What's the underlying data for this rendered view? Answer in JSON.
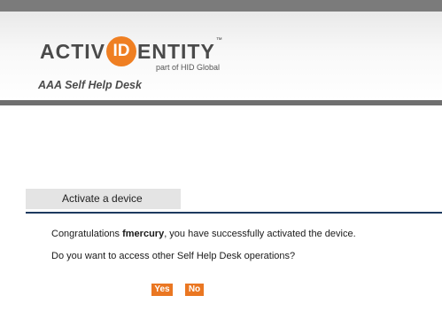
{
  "header": {
    "logo": {
      "text_before": "ACTIV",
      "text_circle": "ID",
      "text_after": "ENTITY",
      "trademark": "™",
      "subtitle": "part of HID Global"
    },
    "app_title": "AAA Self Help Desk"
  },
  "section": {
    "title": "Activate a device"
  },
  "message": {
    "line1_prefix": "Congratulations ",
    "username": "fmercury",
    "line1_suffix": ", you have successfully activated the device.",
    "line2": "Do you want to access other Self Help Desk operations?"
  },
  "buttons": {
    "yes_label": "Yes",
    "no_label": "No"
  },
  "colors": {
    "accent_orange": "#ea7722",
    "header_bar": "#6f6f6f",
    "section_rule": "#1d3a5f"
  }
}
